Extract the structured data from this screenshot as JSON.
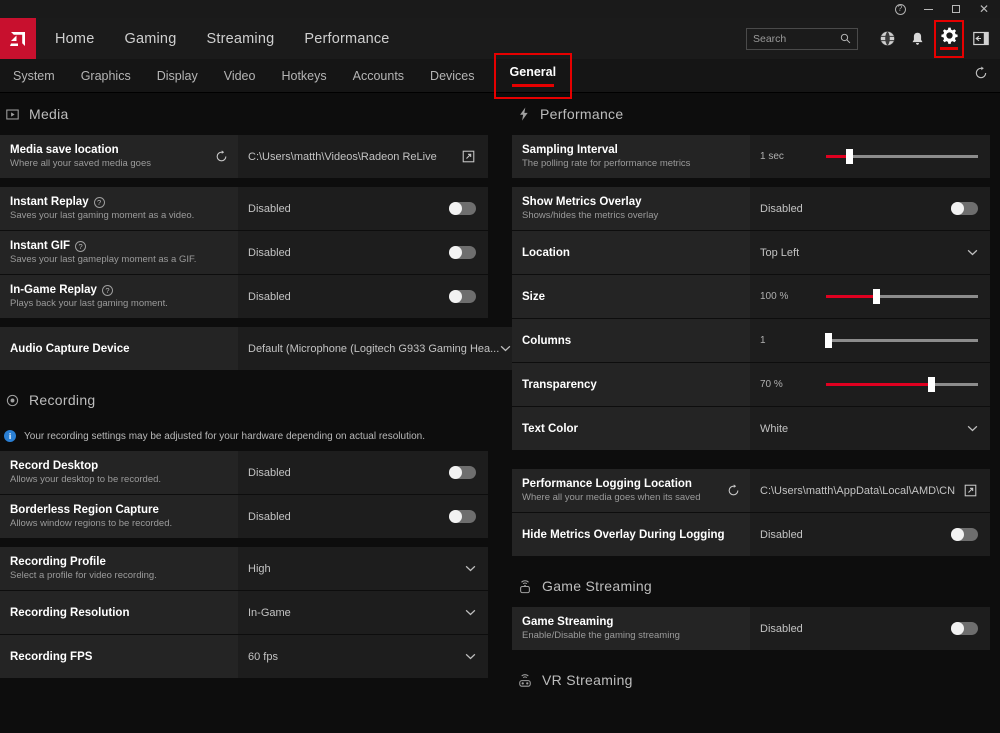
{
  "titlebar": {
    "help_label": "?",
    "minimize_label": "",
    "maximize_label": "",
    "close_label": "✕"
  },
  "header": {
    "logo_name": "amd-logo",
    "nav": [
      {
        "label": "Home",
        "active": false
      },
      {
        "label": "Gaming",
        "active": false
      },
      {
        "label": "Streaming",
        "active": false
      },
      {
        "label": "Performance",
        "active": false
      }
    ],
    "search": {
      "placeholder": "Search",
      "value": ""
    },
    "icons": [
      "globe-icon",
      "bell-icon",
      "gear-icon",
      "panel-toggle-icon"
    ],
    "accent_color": "#e60000"
  },
  "subnav": {
    "tabs": [
      {
        "label": "System"
      },
      {
        "label": "Graphics"
      },
      {
        "label": "Display"
      },
      {
        "label": "Video"
      },
      {
        "label": "Hotkeys"
      },
      {
        "label": "Accounts"
      },
      {
        "label": "Devices"
      }
    ],
    "active_tab": "General",
    "reset_icon": "reset-icon"
  },
  "left_column": {
    "media": {
      "title": "Media",
      "icon": "media-play-icon",
      "rows": [
        {
          "title": "Media save location",
          "subtitle": "Where all your saved media goes",
          "value": "C:\\Users\\matth\\Videos\\Radeon ReLive",
          "control": "path"
        },
        {
          "title": "Instant Replay",
          "subtitle": "Saves your last gaming moment as a video.",
          "value": "Disabled",
          "control": "toggle",
          "help": true
        },
        {
          "title": "Instant GIF",
          "subtitle": "Saves your last gameplay moment as a GIF.",
          "value": "Disabled",
          "control": "toggle",
          "help": true
        },
        {
          "title": "In-Game Replay",
          "subtitle": "Plays back your last gaming moment.",
          "value": "Disabled",
          "control": "toggle",
          "help": true
        },
        {
          "title": "Audio Capture Device",
          "subtitle": "",
          "value": "Default (Microphone (Logitech G933 Gaming Hea...",
          "control": "dropdown"
        }
      ]
    },
    "recording": {
      "title": "Recording",
      "icon": "record-icon",
      "notice": "Your recording settings may be adjusted for your hardware depending on actual resolution.",
      "rows": [
        {
          "title": "Record Desktop",
          "subtitle": "Allows your desktop to be recorded.",
          "value": "Disabled",
          "control": "toggle"
        },
        {
          "title": "Borderless Region Capture",
          "subtitle": "Allows window regions to be recorded.",
          "value": "Disabled",
          "control": "toggle"
        },
        {
          "title": "Recording Profile",
          "subtitle": "Select a profile for video recording.",
          "value": "High",
          "control": "dropdown"
        },
        {
          "title": "Recording Resolution",
          "subtitle": "",
          "value": "In-Game",
          "control": "dropdown"
        },
        {
          "title": "Recording FPS",
          "subtitle": "",
          "value": "60 fps",
          "control": "dropdown"
        }
      ]
    }
  },
  "right_column": {
    "performance": {
      "title": "Performance",
      "icon": "lightning-icon",
      "rows": [
        {
          "title": "Sampling Interval",
          "subtitle": "The polling rate for performance metrics",
          "value": "1 sec",
          "control": "slider",
          "slider_percent": 15
        },
        {
          "title": "Show Metrics Overlay",
          "subtitle": "Shows/hides the metrics overlay",
          "value": "Disabled",
          "control": "toggle"
        },
        {
          "title": "Location",
          "subtitle": "",
          "value": "Top Left",
          "control": "dropdown"
        },
        {
          "title": "Size",
          "subtitle": "",
          "value": "100 %",
          "control": "slider",
          "slider_percent": 33
        },
        {
          "title": "Columns",
          "subtitle": "",
          "value": "1",
          "control": "slider",
          "slider_percent": 1
        },
        {
          "title": "Transparency",
          "subtitle": "",
          "value": "70 %",
          "control": "slider",
          "slider_percent": 69
        },
        {
          "title": "Text Color",
          "subtitle": "",
          "value": "White",
          "control": "dropdown"
        }
      ],
      "logging_rows": [
        {
          "title": "Performance Logging Location",
          "subtitle": "Where all your media goes when its saved",
          "value": "C:\\Users\\matth\\AppData\\Local\\AMD\\CN",
          "control": "path"
        },
        {
          "title": "Hide Metrics Overlay During Logging",
          "subtitle": "",
          "value": "Disabled",
          "control": "toggle"
        }
      ]
    },
    "game_streaming": {
      "title": "Game Streaming",
      "icon": "gamepad-stream-icon",
      "rows": [
        {
          "title": "Game Streaming",
          "subtitle": "Enable/Disable the gaming streaming",
          "value": "Disabled",
          "control": "toggle"
        }
      ]
    },
    "vr_streaming": {
      "title": "VR Streaming",
      "icon": "vr-stream-icon"
    }
  }
}
